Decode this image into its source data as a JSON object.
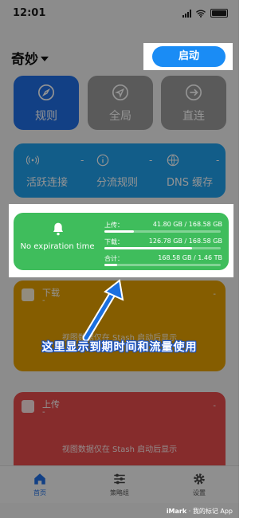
{
  "status_bar": {
    "time": "12:01"
  },
  "header": {
    "profile_name": "奇妙",
    "start_button": "启动"
  },
  "modes": [
    {
      "label": "规则",
      "icon": "compass-icon",
      "color": "#1f6fe5"
    },
    {
      "label": "全局",
      "icon": "navigation-icon",
      "color": "#9b9b9b"
    },
    {
      "label": "直连",
      "icon": "arrow-right-circle-icon",
      "color": "#9b9b9b"
    }
  ],
  "stats": [
    {
      "label": "活跃连接",
      "value": "-",
      "icon": "broadcast-icon"
    },
    {
      "label": "分流规则",
      "value": "-",
      "icon": "info-icon"
    },
    {
      "label": "DNS 缓存",
      "value": "-",
      "icon": "globe-icon"
    }
  ],
  "expiry_card": {
    "title": "No expiration time",
    "icon": "bell-icon",
    "rows": [
      {
        "key": "上传：",
        "value": "41.80 GB / 168.58 GB",
        "fraction": 0.25
      },
      {
        "key": "下载：",
        "value": "126.78 GB / 168.58 GB",
        "fraction": 0.75
      },
      {
        "key": "合计：",
        "value": "168.58 GB / 1.46 TB",
        "fraction": 0.11
      }
    ]
  },
  "traffic": {
    "download": {
      "title": "下载",
      "value": "-",
      "right_value": "-",
      "note": "视图数据仅在 Stash 启动后显示"
    },
    "upload": {
      "title": "上传",
      "value": "-",
      "right_value": "-",
      "note": "视图数据仅在 Stash 启动后显示"
    }
  },
  "annotation": "这里显示到期时间和流量使用",
  "tabs": [
    {
      "label": "首页",
      "icon": "home-icon",
      "active": true
    },
    {
      "label": "策略组",
      "icon": "sliders-icon",
      "active": false
    },
    {
      "label": "设置",
      "icon": "gear-icon",
      "active": false
    }
  ],
  "watermark": {
    "brand": "iMark",
    "tagline": "· 我的标记 App"
  },
  "colors": {
    "accent": "#1a8cf5",
    "green": "#3fbd5c",
    "orange": "#e6a000",
    "red": "#e74c4c",
    "stats_blue": "#1fa0ec"
  }
}
